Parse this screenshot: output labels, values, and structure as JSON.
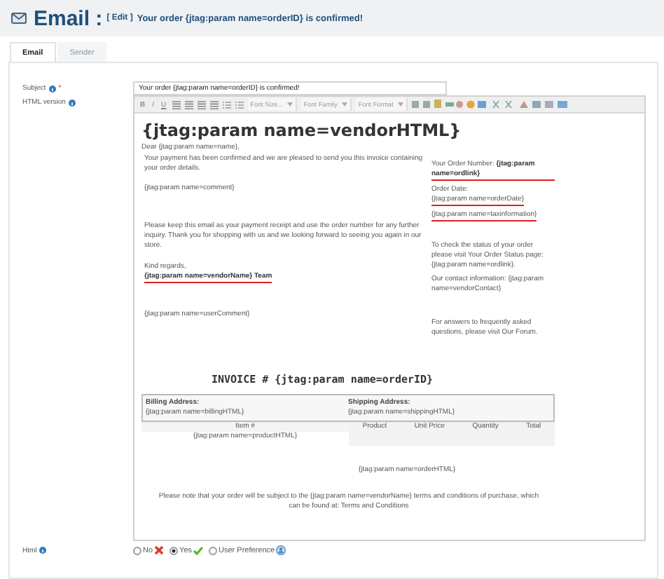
{
  "header": {
    "title": "Email :",
    "edit_label": "[ Edit ]",
    "subtitle": "Your order {jtag:param name=orderID} is confirmed!"
  },
  "tabs": [
    {
      "label": "Email",
      "selected": true
    },
    {
      "label": "Sender",
      "selected": false
    }
  ],
  "subject": {
    "label": "Subject",
    "required_mark": "*",
    "value": "Your order {jtag:param name=orderID} is confirmed!"
  },
  "html_version": {
    "label": "HTML version"
  },
  "toolbar": {
    "format_buttons": [
      "B",
      "I",
      "U"
    ],
    "dropdowns": [
      "Font Size...",
      "Font Family",
      "Font Format"
    ]
  },
  "editor": {
    "heading": "{jtag:param name=vendorHTML}",
    "greeting": "Dear {jtag:param name=name},",
    "left": [
      {
        "text": "Your payment has been confirmed and we are pleased to send you this invoice containing your order details.",
        "underlined": false
      },
      {
        "text": "{jtag:param name=comment}",
        "underlined": false
      },
      {
        "text": "Please keep this email as your payment receipt and use the order number for any further inquiry. Thank you for shopping with us and we looking forward to seeing you again in our store.",
        "underlined": false
      },
      {
        "text": "Kind regards,",
        "underlined": false
      },
      {
        "text": "**{jtag:param name=vendorName} Team**",
        "underlined": true
      },
      {
        "text": "{jtag:param name=userComment}",
        "underlined": false
      }
    ],
    "right": [
      {
        "text": "Your Order Number: **{jtag:param name=ordlink}**",
        "underlined": true
      },
      {
        "text": "Order Date:",
        "underlined": false
      },
      {
        "text": "{jtag:param name=orderDate}",
        "underlined": true
      },
      {
        "text": "{jtag:param name=taxinformation}",
        "underlined": true
      },
      {
        "text": "To check the status of your order please visit Your Order Status page: {jtag:param name=ordlink}.",
        "underlined": false
      },
      {
        "text": "Our contact information: {jtag:param name=vendorContact}",
        "underlined": false
      },
      {
        "text": "For answers to frequently asked questions, please visit Our Forum.",
        "underlined": false
      }
    ],
    "invoice": {
      "title": "INVOICE # {jtag:param name=orderID}",
      "billing": {
        "label": "Billing Address:",
        "value": "{jtag:param name=billingHTML}"
      },
      "shipping": {
        "label": "Shipping Address:",
        "value": "{jtag:param name=shippingHTML}"
      },
      "item_column": "Item #",
      "product_columns": [
        "Product",
        "Unit Price",
        "Quantity",
        "Total"
      ],
      "product_html": "{jtag:param name=productHTML}",
      "order_html": "{jtag:param name=orderHTML}",
      "note": "Please note that your order will be subject to the {jtag:param name=vendorName} terms and conditions of purchase, which can be found at: Terms and Conditions"
    }
  },
  "html_option": {
    "label": "Html",
    "options": [
      {
        "label": "No",
        "selected": false,
        "kind": "no"
      },
      {
        "label": "Yes",
        "selected": true,
        "kind": "yes"
      },
      {
        "label": "User Preference",
        "selected": false,
        "kind": "pref"
      }
    ]
  }
}
